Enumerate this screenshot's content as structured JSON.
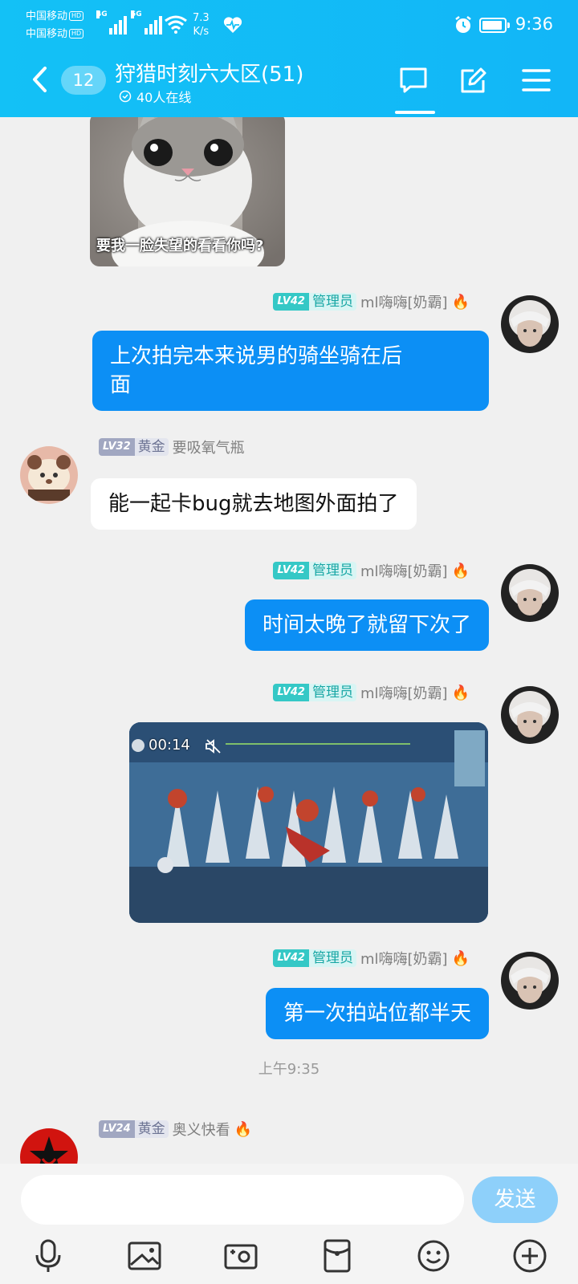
{
  "status_bar": {
    "carrier_1": "中国移动",
    "carrier_2": "中国移动",
    "hd": "HD",
    "net_1": "4G",
    "net_2": "5G",
    "speed_value": "7.3",
    "speed_unit": "K/s",
    "time": "9:36",
    "battery_level": 0.8
  },
  "header": {
    "unread_count": "12",
    "title": "狩猎时刻六大区(51)",
    "online": "40人在线",
    "icons": [
      "back-icon",
      "chat-icon",
      "edit-icon",
      "menu-icon"
    ]
  },
  "messages": [
    {
      "type": "image",
      "caption": "要我一脸失望的看看你吗?"
    },
    {
      "type": "text",
      "side": "out",
      "level": "LV42",
      "role": "管理员",
      "nick": "ml嗨嗨[奶霸]",
      "text": "上次拍完本来说男的骑坐骑在后\n面"
    },
    {
      "type": "text",
      "side": "in",
      "level": "LV32",
      "role": "黄金",
      "nick": "要吸氧气瓶",
      "text": "能一起卡bug就去地图外面拍了"
    },
    {
      "type": "text",
      "side": "out",
      "level": "LV42",
      "role": "管理员",
      "nick": "ml嗨嗨[奶霸]",
      "text": "时间太晚了就留下次了"
    },
    {
      "type": "video",
      "side": "out",
      "level": "LV42",
      "role": "管理员",
      "nick": "ml嗨嗨[奶霸]",
      "duration": "00:14"
    },
    {
      "type": "text",
      "side": "out",
      "level": "LV42",
      "role": "管理员",
      "nick": "ml嗨嗨[奶霸]",
      "text": "第一次拍站位都半天"
    },
    {
      "type": "timestamp",
      "text": "上午9:35"
    },
    {
      "type": "text",
      "side": "in",
      "level": "LV24",
      "role": "黄金",
      "nick": "奥义快看"
    }
  ],
  "input": {
    "placeholder": "",
    "send_label": "发送",
    "tools": [
      "microphone-icon",
      "image-icon",
      "camera-icon",
      "red-packet-icon",
      "emoji-icon",
      "plus-icon"
    ]
  },
  "colors": {
    "header_bg": "#13c1f6",
    "bubble_out": "#0c8ff5",
    "bubble_in": "#ffffff",
    "admin_badge": "#35c8c6",
    "gold_badge": "#a1a7c1",
    "send_button": "#8ed0fa"
  }
}
